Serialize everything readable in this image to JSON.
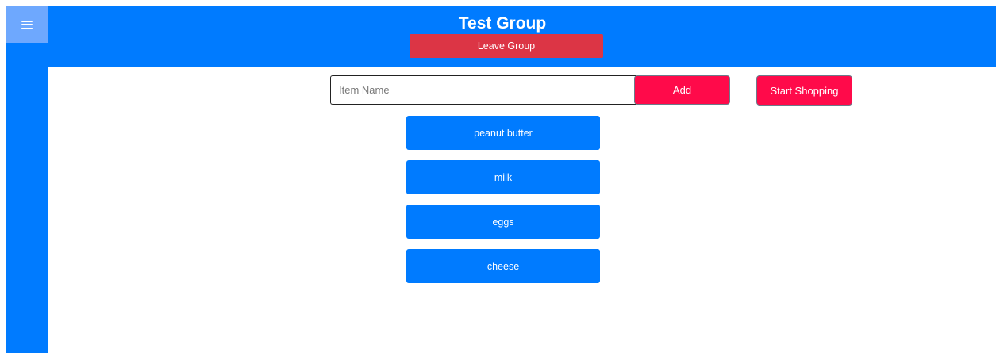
{
  "header": {
    "title": "Test Group",
    "leave_label": "Leave Group",
    "menu_icon": "hamburger-menu-icon"
  },
  "add_form": {
    "placeholder": "Item Name",
    "value": "",
    "add_label": "Add",
    "start_shopping_label": "Start Shopping"
  },
  "items": [
    {
      "label": "peanut butter"
    },
    {
      "label": "milk"
    },
    {
      "label": "eggs"
    },
    {
      "label": "cheese"
    }
  ],
  "colors": {
    "primary": "#007bff",
    "danger": "#dc3545",
    "accent": "#ff0a4a",
    "menu_button": "#6ea8fe"
  }
}
